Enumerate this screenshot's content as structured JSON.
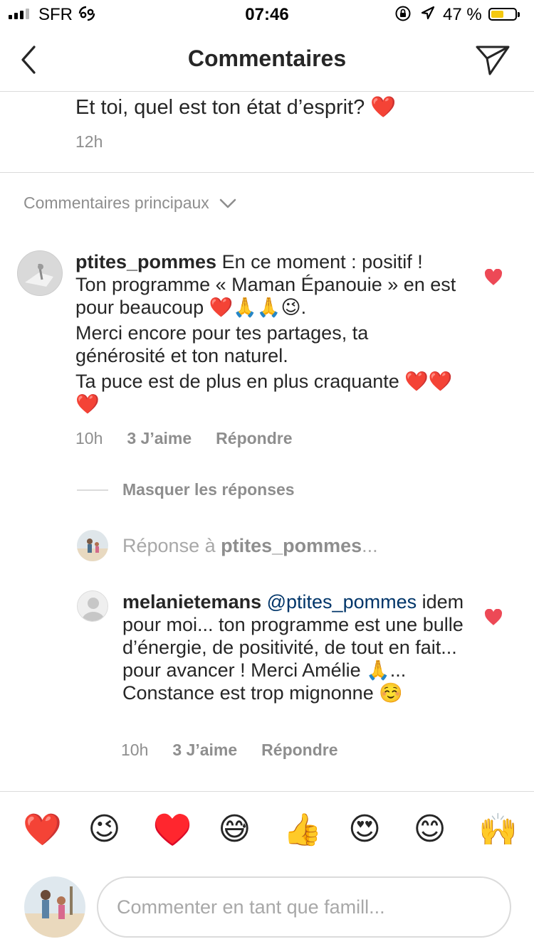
{
  "status_bar": {
    "carrier": "SFR",
    "time": "07:46",
    "battery_percent": "47 %",
    "battery_level": 0.47,
    "battery_color": "#f5c90f"
  },
  "header": {
    "title": "Commentaires",
    "back_icon": "chevron-left-icon",
    "send_icon": "paper-plane-icon"
  },
  "caption": {
    "text": "Et toi, quel est ton état d’esprit? ❤️",
    "time": "12h"
  },
  "filter": {
    "label": "Commentaires principaux",
    "icon": "chevron-down-icon"
  },
  "comments": [
    {
      "username": "ptites_pommes",
      "lines": [
        "En ce moment : positif !",
        "Ton programme « Maman Épanouie » en est pour beaucoup ❤️🙏🙏😉.",
        "Merci encore pour tes partages, ta générosité et ton naturel.",
        "Ta puce est de plus en plus craquante ❤️❤️❤️"
      ],
      "time": "10h",
      "likes": "3 J’aime",
      "reply_label": "Répondre"
    }
  ],
  "replies_toggle": "Masquer les réponses",
  "reply_to": {
    "prefix": "Réponse à ",
    "username": "ptites_pommes",
    "suffix": "..."
  },
  "reply": {
    "username": "melanietemans",
    "mention": "@ptites_pommes",
    "text": "idem pour moi... ton programme est une bulle d’énergie, de positivité, de tout en fait... pour avancer ! Merci Amélie 🙏... Constance est trop mignonne ☺️",
    "time": "10h",
    "likes": "3 J’aime",
    "reply_label": "Répondre"
  },
  "quick_emojis": [
    "❤️",
    "😉",
    "♥️",
    "😅",
    "👍",
    "😍",
    "😊",
    "🙌"
  ],
  "comment_input": {
    "placeholder": "Commenter en tant que famill..."
  },
  "colors": {
    "like_heart": "#ed4956",
    "mention": "#003569",
    "secondary_text": "#8e8e8e",
    "divider": "#dbdbdb"
  }
}
